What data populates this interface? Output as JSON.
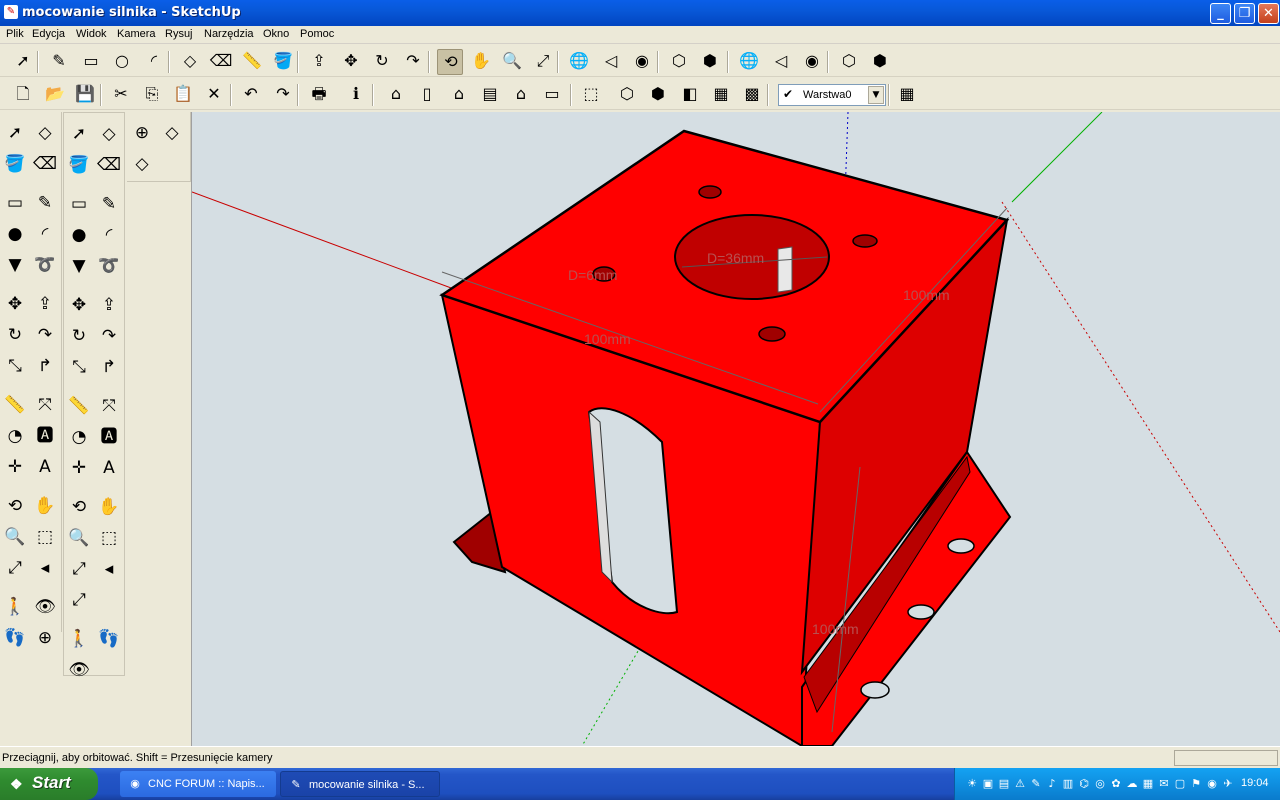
{
  "window": {
    "title": "mocowanie silnika - SketchUp"
  },
  "menu": [
    "Plik",
    "Edycja",
    "Widok",
    "Kamera",
    "Rysuj",
    "Narzędzia",
    "Okno",
    "Pomoc"
  ],
  "toolbar1": [
    {
      "name": "select-tool",
      "glyph": "➚"
    },
    {
      "name": "pencil-tool",
      "glyph": "✎"
    },
    {
      "name": "rectangle-tool",
      "glyph": "▭"
    },
    {
      "name": "circle-tool",
      "glyph": "○"
    },
    {
      "name": "arc-tool",
      "glyph": "◜"
    },
    {
      "name": "make-component",
      "glyph": "◇"
    },
    {
      "name": "eraser-tool",
      "glyph": "⌫"
    },
    {
      "name": "tape-measure",
      "glyph": "📏"
    },
    {
      "name": "paint-bucket",
      "glyph": "🪣"
    },
    {
      "name": "push-pull",
      "glyph": "⇪"
    },
    {
      "name": "move-tool",
      "glyph": "✥"
    },
    {
      "name": "rotate-tool",
      "glyph": "↻"
    },
    {
      "name": "follow-me",
      "glyph": "↷"
    },
    {
      "name": "orbit-tool",
      "glyph": "⟲"
    },
    {
      "name": "pan-tool",
      "glyph": "✋"
    },
    {
      "name": "zoom-tool",
      "glyph": "🔍"
    },
    {
      "name": "zoom-extents",
      "glyph": "⤢"
    },
    {
      "name": "get-models",
      "glyph": "🌐"
    },
    {
      "name": "share-model",
      "glyph": "◁"
    },
    {
      "name": "share-component",
      "glyph": "◉"
    },
    {
      "name": "get-photo-texture",
      "glyph": "⬡"
    },
    {
      "name": "building-maker",
      "glyph": "⬢"
    },
    {
      "name": "get-models-2",
      "glyph": "🌐"
    },
    {
      "name": "share-model-2",
      "glyph": "◁"
    },
    {
      "name": "share-component-2",
      "glyph": "◉"
    },
    {
      "name": "photo-texture-2",
      "glyph": "⬡"
    },
    {
      "name": "building-maker-2",
      "glyph": "⬢"
    }
  ],
  "toolbar2": [
    {
      "name": "new-file",
      "glyph": "🗋"
    },
    {
      "name": "open-file",
      "glyph": "📂"
    },
    {
      "name": "save-file",
      "glyph": "💾"
    },
    {
      "name": "cut",
      "glyph": "✂"
    },
    {
      "name": "copy",
      "glyph": "⎘"
    },
    {
      "name": "paste",
      "glyph": "📋"
    },
    {
      "name": "delete",
      "glyph": "✕"
    },
    {
      "name": "undo",
      "glyph": "↶"
    },
    {
      "name": "redo",
      "glyph": "↷"
    },
    {
      "name": "print",
      "glyph": "🖶"
    },
    {
      "name": "model-info",
      "glyph": "ℹ"
    },
    {
      "name": "iso-view",
      "glyph": "⌂"
    },
    {
      "name": "top-view",
      "glyph": "▯"
    },
    {
      "name": "front-view",
      "glyph": "⌂"
    },
    {
      "name": "right-view",
      "glyph": "▤"
    },
    {
      "name": "back-view",
      "glyph": "⌂"
    },
    {
      "name": "left-view",
      "glyph": "▭"
    },
    {
      "name": "xray-style",
      "glyph": "⬚"
    },
    {
      "name": "wireframe-style",
      "glyph": "⬡"
    },
    {
      "name": "hidden-line-style",
      "glyph": "⬢"
    },
    {
      "name": "shaded-style",
      "glyph": "◧"
    },
    {
      "name": "textured-style",
      "glyph": "▦"
    },
    {
      "name": "monochrome-style",
      "glyph": "▩"
    }
  ],
  "layers": {
    "current": "Warstwa0",
    "check": "✔"
  },
  "palette_glyphs": {
    "select": "➚",
    "component": "◇",
    "paint": "🪣",
    "eraser": "⌫",
    "rect": "▭",
    "pencil": "✎",
    "circle": "●",
    "arc": "◜",
    "polygon": "▼",
    "freehand": "➰",
    "move": "✥",
    "pushpull": "⇪",
    "rotate": "↻",
    "followme": "↷",
    "scale": "⤡",
    "offset": "↱",
    "tape": "📏",
    "dim": "⤧",
    "protractor": "◔",
    "text": "🅰",
    "axes": "✛",
    "text3d": "A",
    "orbit": "⟲",
    "pan": "✋",
    "zoom": "🔍",
    "zoomwin": "⬚",
    "zoomext": "⤢",
    "prev": "◂",
    "walk": "🚶",
    "look": "👁",
    "position": "👣",
    "section": "⊕"
  },
  "viewport": {
    "dimensions": [
      "100mm",
      "100mm",
      "100mm"
    ],
    "circle_labels": [
      "D=6mm",
      "D=36mm"
    ]
  },
  "status": {
    "message": "Przeciągnij, aby orbitować. Shift = Przesunięcie kamery",
    "measurements": ""
  },
  "taskbar": {
    "start": "Start",
    "tasks": [
      {
        "label": "CNC FORUM :: Napis...",
        "icon": "◉"
      },
      {
        "label": "mocowanie silnika - S...",
        "icon": "✎"
      }
    ],
    "clock": "19:04"
  },
  "colors": {
    "model_red": "#FF0000",
    "viewport_bg": "#D5DEE3",
    "axis_red": "#C80000",
    "axis_green": "#00B000",
    "axis_blue": "#0000C8"
  }
}
